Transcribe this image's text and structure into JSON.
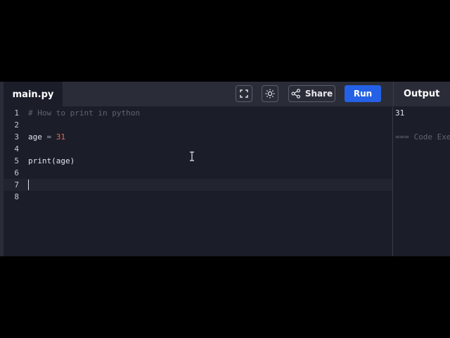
{
  "editor": {
    "file_name": "main.py",
    "lines": [
      {
        "number": "1",
        "text": "# How to print in python"
      },
      {
        "number": "2",
        "text": ""
      },
      {
        "number": "3",
        "var": "age",
        "op": " = ",
        "value": "31"
      },
      {
        "number": "4",
        "text": ""
      },
      {
        "number": "5",
        "fn": "print",
        "args": "(age)"
      },
      {
        "number": "6",
        "text": ""
      },
      {
        "number": "7",
        "text": ""
      },
      {
        "number": "8",
        "text": ""
      }
    ]
  },
  "toolbar": {
    "fullscreen_icon": "fullscreen-icon",
    "theme_icon": "sun-icon",
    "share_label": "Share",
    "share_icon": "share-icon",
    "run_label": "Run",
    "run_color": "#2461e6"
  },
  "output": {
    "tab_label": "Output",
    "value": "31",
    "status": "=== Code Exe"
  }
}
